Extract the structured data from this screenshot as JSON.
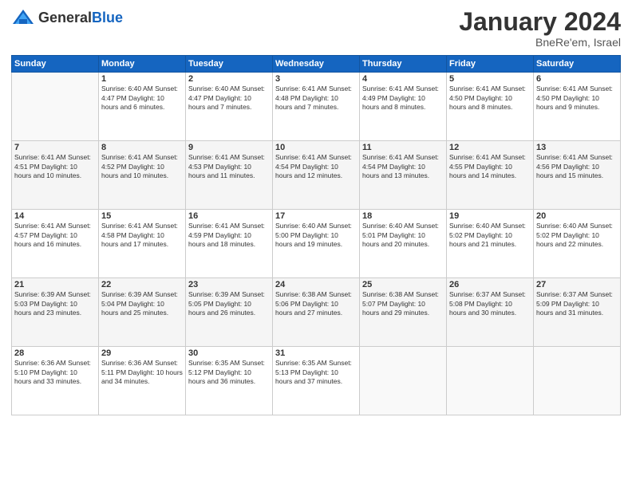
{
  "header": {
    "logo_general": "General",
    "logo_blue": "Blue",
    "month": "January 2024",
    "location": "BneRe'em, Israel"
  },
  "weekdays": [
    "Sunday",
    "Monday",
    "Tuesday",
    "Wednesday",
    "Thursday",
    "Friday",
    "Saturday"
  ],
  "weeks": [
    [
      {
        "day": "",
        "info": ""
      },
      {
        "day": "1",
        "info": "Sunrise: 6:40 AM\nSunset: 4:47 PM\nDaylight: 10 hours\nand 6 minutes."
      },
      {
        "day": "2",
        "info": "Sunrise: 6:40 AM\nSunset: 4:47 PM\nDaylight: 10 hours\nand 7 minutes."
      },
      {
        "day": "3",
        "info": "Sunrise: 6:41 AM\nSunset: 4:48 PM\nDaylight: 10 hours\nand 7 minutes."
      },
      {
        "day": "4",
        "info": "Sunrise: 6:41 AM\nSunset: 4:49 PM\nDaylight: 10 hours\nand 8 minutes."
      },
      {
        "day": "5",
        "info": "Sunrise: 6:41 AM\nSunset: 4:50 PM\nDaylight: 10 hours\nand 8 minutes."
      },
      {
        "day": "6",
        "info": "Sunrise: 6:41 AM\nSunset: 4:50 PM\nDaylight: 10 hours\nand 9 minutes."
      }
    ],
    [
      {
        "day": "7",
        "info": "Sunrise: 6:41 AM\nSunset: 4:51 PM\nDaylight: 10 hours\nand 10 minutes."
      },
      {
        "day": "8",
        "info": "Sunrise: 6:41 AM\nSunset: 4:52 PM\nDaylight: 10 hours\nand 10 minutes."
      },
      {
        "day": "9",
        "info": "Sunrise: 6:41 AM\nSunset: 4:53 PM\nDaylight: 10 hours\nand 11 minutes."
      },
      {
        "day": "10",
        "info": "Sunrise: 6:41 AM\nSunset: 4:54 PM\nDaylight: 10 hours\nand 12 minutes."
      },
      {
        "day": "11",
        "info": "Sunrise: 6:41 AM\nSunset: 4:54 PM\nDaylight: 10 hours\nand 13 minutes."
      },
      {
        "day": "12",
        "info": "Sunrise: 6:41 AM\nSunset: 4:55 PM\nDaylight: 10 hours\nand 14 minutes."
      },
      {
        "day": "13",
        "info": "Sunrise: 6:41 AM\nSunset: 4:56 PM\nDaylight: 10 hours\nand 15 minutes."
      }
    ],
    [
      {
        "day": "14",
        "info": "Sunrise: 6:41 AM\nSunset: 4:57 PM\nDaylight: 10 hours\nand 16 minutes."
      },
      {
        "day": "15",
        "info": "Sunrise: 6:41 AM\nSunset: 4:58 PM\nDaylight: 10 hours\nand 17 minutes."
      },
      {
        "day": "16",
        "info": "Sunrise: 6:41 AM\nSunset: 4:59 PM\nDaylight: 10 hours\nand 18 minutes."
      },
      {
        "day": "17",
        "info": "Sunrise: 6:40 AM\nSunset: 5:00 PM\nDaylight: 10 hours\nand 19 minutes."
      },
      {
        "day": "18",
        "info": "Sunrise: 6:40 AM\nSunset: 5:01 PM\nDaylight: 10 hours\nand 20 minutes."
      },
      {
        "day": "19",
        "info": "Sunrise: 6:40 AM\nSunset: 5:02 PM\nDaylight: 10 hours\nand 21 minutes."
      },
      {
        "day": "20",
        "info": "Sunrise: 6:40 AM\nSunset: 5:02 PM\nDaylight: 10 hours\nand 22 minutes."
      }
    ],
    [
      {
        "day": "21",
        "info": "Sunrise: 6:39 AM\nSunset: 5:03 PM\nDaylight: 10 hours\nand 23 minutes."
      },
      {
        "day": "22",
        "info": "Sunrise: 6:39 AM\nSunset: 5:04 PM\nDaylight: 10 hours\nand 25 minutes."
      },
      {
        "day": "23",
        "info": "Sunrise: 6:39 AM\nSunset: 5:05 PM\nDaylight: 10 hours\nand 26 minutes."
      },
      {
        "day": "24",
        "info": "Sunrise: 6:38 AM\nSunset: 5:06 PM\nDaylight: 10 hours\nand 27 minutes."
      },
      {
        "day": "25",
        "info": "Sunrise: 6:38 AM\nSunset: 5:07 PM\nDaylight: 10 hours\nand 29 minutes."
      },
      {
        "day": "26",
        "info": "Sunrise: 6:37 AM\nSunset: 5:08 PM\nDaylight: 10 hours\nand 30 minutes."
      },
      {
        "day": "27",
        "info": "Sunrise: 6:37 AM\nSunset: 5:09 PM\nDaylight: 10 hours\nand 31 minutes."
      }
    ],
    [
      {
        "day": "28",
        "info": "Sunrise: 6:36 AM\nSunset: 5:10 PM\nDaylight: 10 hours\nand 33 minutes."
      },
      {
        "day": "29",
        "info": "Sunrise: 6:36 AM\nSunset: 5:11 PM\nDaylight: 10 hours\nand 34 minutes."
      },
      {
        "day": "30",
        "info": "Sunrise: 6:35 AM\nSunset: 5:12 PM\nDaylight: 10 hours\nand 36 minutes."
      },
      {
        "day": "31",
        "info": "Sunrise: 6:35 AM\nSunset: 5:13 PM\nDaylight: 10 hours\nand 37 minutes."
      },
      {
        "day": "",
        "info": ""
      },
      {
        "day": "",
        "info": ""
      },
      {
        "day": "",
        "info": ""
      }
    ]
  ]
}
